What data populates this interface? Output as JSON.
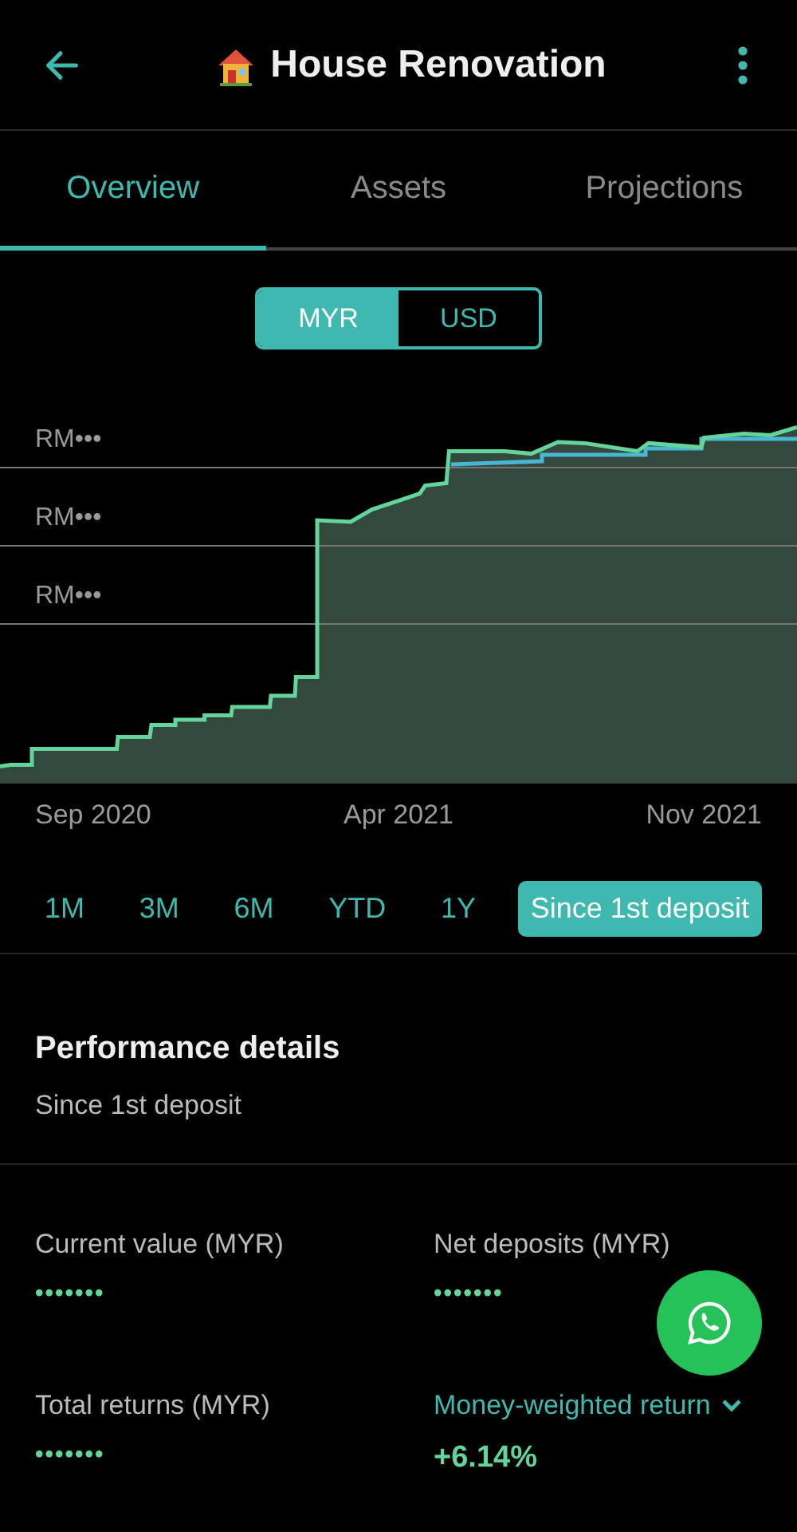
{
  "header": {
    "title": "House Renovation"
  },
  "tabs": [
    {
      "label": "Overview",
      "selected": true
    },
    {
      "label": "Assets",
      "selected": false
    },
    {
      "label": "Projections",
      "selected": false
    }
  ],
  "currency": [
    {
      "label": "MYR",
      "selected": true
    },
    {
      "label": "USD",
      "selected": false
    }
  ],
  "chart": {
    "y_labels": [
      "RM•••",
      "RM•••",
      "RM•••"
    ],
    "x_labels": [
      "Sep 2020",
      "Apr 2021",
      "Nov 2021"
    ]
  },
  "periods": [
    {
      "label": "1M",
      "selected": false
    },
    {
      "label": "3M",
      "selected": false
    },
    {
      "label": "6M",
      "selected": false
    },
    {
      "label": "YTD",
      "selected": false
    },
    {
      "label": "1Y",
      "selected": false
    },
    {
      "label": "Since 1st deposit",
      "selected": true
    }
  ],
  "performance": {
    "title": "Performance details",
    "subtitle": "Since 1st deposit",
    "metrics": [
      {
        "kind": "plain",
        "label": "Current value (MYR)",
        "value": "•••••••"
      },
      {
        "kind": "plain",
        "label": "Net deposits (MYR)",
        "value": "•••••••"
      },
      {
        "kind": "plain",
        "label": "Total returns (MYR)",
        "value": "•••••••"
      },
      {
        "kind": "dropdown",
        "label": "Money-weighted return",
        "value": "+6.14%"
      }
    ]
  }
}
